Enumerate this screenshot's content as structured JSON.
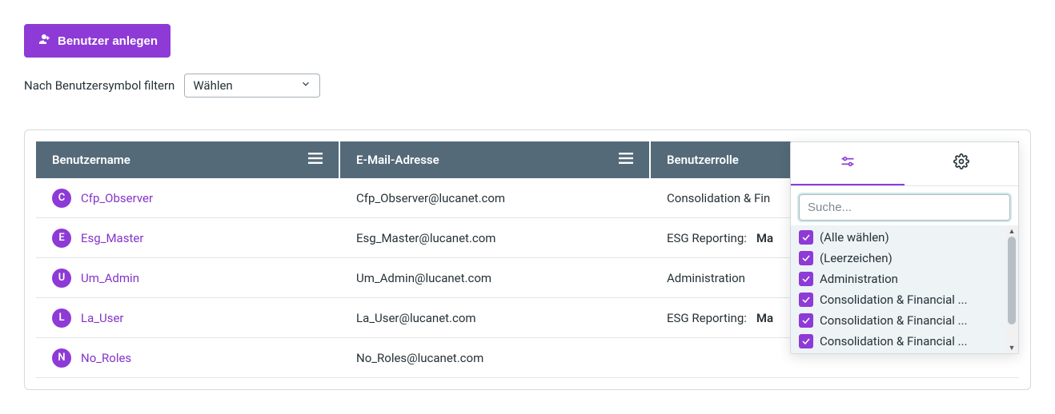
{
  "toolbar": {
    "create_user_label": "Benutzer anlegen"
  },
  "filter": {
    "label": "Nach Benutzersymbol filtern",
    "select_placeholder": "Wählen"
  },
  "table": {
    "columns": {
      "username": "Benutzername",
      "email": "E-Mail-Adresse",
      "role": "Benutzerrolle"
    },
    "rows": [
      {
        "avatar": "C",
        "username": "Cfp_Observer",
        "email": "Cfp_Observer@lucanet.com",
        "role_text": "Consolidation & Fin",
        "role_suffix": ""
      },
      {
        "avatar": "E",
        "username": "Esg_Master",
        "email": "Esg_Master@lucanet.com",
        "role_text": "ESG Reporting: ",
        "role_suffix": "Ma"
      },
      {
        "avatar": "U",
        "username": "Um_Admin",
        "email": "Um_Admin@lucanet.com",
        "role_text": "Administration",
        "role_suffix": ""
      },
      {
        "avatar": "L",
        "username": "La_User",
        "email": "La_User@lucanet.com",
        "role_text": "ESG Reporting: ",
        "role_suffix": "Ma"
      },
      {
        "avatar": "N",
        "username": "No_Roles",
        "email": "No_Roles@lucanet.com",
        "role_text": "",
        "role_suffix": ""
      }
    ]
  },
  "role_filter": {
    "search_placeholder": "Suche...",
    "options": [
      "(Alle wählen)",
      "(Leerzeichen)",
      "Administration",
      "Consolidation & Financial ...",
      "Consolidation & Financial ...",
      "Consolidation & Financial ..."
    ]
  }
}
